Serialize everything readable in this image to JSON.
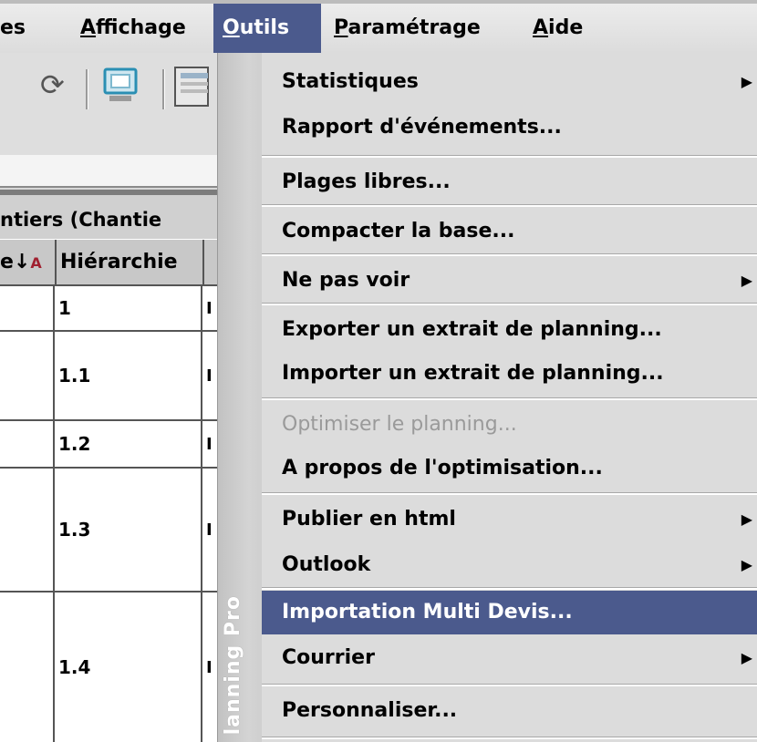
{
  "menubar": {
    "items": [
      {
        "label": "es",
        "underline": ""
      },
      {
        "label": "ffichage",
        "underline": "A"
      },
      {
        "label": "utils",
        "underline": "O"
      },
      {
        "label": "aramétrage",
        "underline": "P"
      },
      {
        "label": "ide",
        "underline": "A"
      }
    ]
  },
  "toolbar": {
    "icons": [
      "refresh-icon",
      "monitor-icon",
      "grid-icon"
    ],
    "refresh_glyph": "⟳",
    "monitor_glyph": "🖵"
  },
  "grid": {
    "title": "ntiers (Chantie",
    "sort_arrow": "e↓",
    "sort_az": "A Z",
    "column_header": "Hiérarchie",
    "rows": [
      {
        "hier": "1",
        "next": "I"
      },
      {
        "hier": "1.1",
        "next": "I"
      },
      {
        "hier": "1.2",
        "next": "I"
      },
      {
        "hier": "1.3",
        "next": "I"
      },
      {
        "hier": "1.4",
        "next": "I"
      }
    ]
  },
  "dropdown": {
    "sidebar_text": "lanning Pro",
    "items": [
      {
        "label": "Statistiques",
        "submenu": true
      },
      {
        "label": "Rapport d'événements..."
      },
      {
        "label": "Plages libres..."
      },
      {
        "label": "Compacter la base..."
      },
      {
        "label": "Ne pas voir",
        "submenu": true
      },
      {
        "label": "Exporter un extrait de planning..."
      },
      {
        "label": "Importer un extrait de planning..."
      },
      {
        "label": "Optimiser le planning...",
        "disabled": true
      },
      {
        "label": "A propos de l'optimisation..."
      },
      {
        "label": "Publier en html",
        "submenu": true
      },
      {
        "label": "Outlook",
        "submenu": true
      },
      {
        "label": "Importation Multi Devis...",
        "highlighted": true
      },
      {
        "label": "Courrier",
        "submenu": true
      },
      {
        "label": "Personnaliser..."
      }
    ],
    "submenu_arrow": "▶"
  },
  "colors": {
    "highlight": "#4b5a8d",
    "menu_bg": "#dcdcdc",
    "disabled_text": "#9a9a9a"
  }
}
